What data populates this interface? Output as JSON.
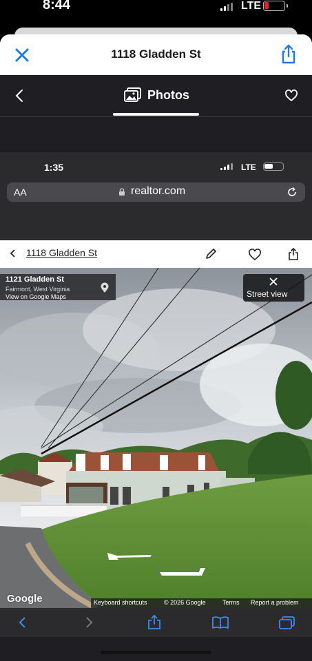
{
  "status_bar": {
    "time": "8:44",
    "network": "LTE",
    "battery_color": "#e8262a"
  },
  "sheet": {
    "title": "1118 Gladden St"
  },
  "photos_bar": {
    "title": "Photos"
  },
  "inner_screenshot": {
    "status_bar": {
      "time": "1:35",
      "network": "LTE"
    },
    "url_bar": {
      "text_size_label": "AA",
      "domain": "realtor.com"
    },
    "listing_header": {
      "title": "1118 Gladden St"
    },
    "street_view": {
      "address": "1121 Gladden St",
      "city": "Fairmont, West Virginia",
      "maps_link": "View on Google Maps",
      "exit_label": "Street view",
      "brand": "Google",
      "footer": [
        "Keyboard shortcuts",
        "© 2026 Google",
        "Terms",
        "Report a problem"
      ]
    },
    "toolbar": [
      "back-icon",
      "forward-icon",
      "share-icon",
      "bookmarks-icon",
      "tabs-icon"
    ]
  },
  "colors": {
    "accent_blue": "#1f7ae0",
    "dark_bar": "#1f1f23"
  }
}
